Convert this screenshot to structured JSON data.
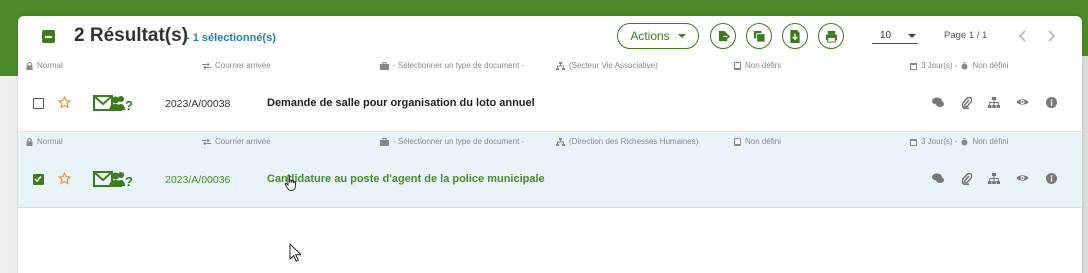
{
  "header": {
    "result_title": "2 Résultat(s)",
    "selection_info": "- 1 sélectionné(s)",
    "actions_label": "Actions",
    "per_page": "10",
    "page_info": "Page 1 / 1"
  },
  "icons": {
    "actions": [
      "export-icon",
      "layers-icon",
      "document-download-icon",
      "print-icon"
    ],
    "row_actions": [
      "chat-icon",
      "attachment-icon",
      "hierarchy-icon",
      "eye-icon",
      "info-icon"
    ]
  },
  "colors": {
    "brand_green": "#4d8a2c",
    "selected_row_bg": "#e8f4f8",
    "link_blue": "#2a7fb0",
    "star_orange": "#e8963a"
  },
  "rows": [
    {
      "priority": "Normal",
      "mail_type": "Courrier arrivée",
      "doc_type": "- Sélectionner un type de document -",
      "department": "(Secteur Vie Associative)",
      "status": "Non défini",
      "deadline": "3 Jour(s) - ",
      "deadline_status": "Non défini",
      "reference": "2023/A/00038",
      "subject": "Demande de salle pour organisation du loto annuel",
      "checked": false
    },
    {
      "priority": "Normal",
      "mail_type": "Courrier arrivée",
      "doc_type": "- Sélectionner un type de document -",
      "department": "(Direction des Richesses Humaines)",
      "status": "Non défini",
      "deadline": "3 Jour(s) - ",
      "deadline_status": "Non défini",
      "reference": "2023/A/00036",
      "subject": "Candidature au poste d'agent de la police municipale",
      "checked": true
    }
  ]
}
